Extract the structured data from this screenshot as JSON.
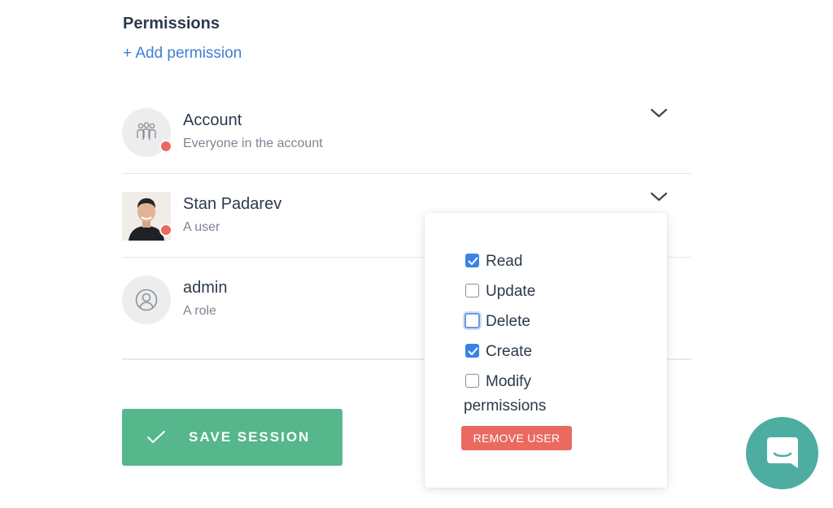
{
  "permissions": {
    "title": "Permissions",
    "add_label": "+ Add permission"
  },
  "entries": [
    {
      "name": "Account",
      "subtitle": "Everyone in the account",
      "icon": "people-group-icon",
      "status": "red"
    },
    {
      "name": "Stan Padarev",
      "subtitle": "A user",
      "icon": "user-photo",
      "status": "red"
    },
    {
      "name": "admin",
      "subtitle": "A role",
      "icon": "user-circle-icon"
    }
  ],
  "popover": {
    "options": [
      {
        "label": "Read",
        "checked": true
      },
      {
        "label": "Update",
        "checked": false
      },
      {
        "label": "Delete",
        "checked": false,
        "focused": true
      },
      {
        "label": "Create",
        "checked": true
      },
      {
        "label": "Modify",
        "label2": "permissions",
        "checked": false
      }
    ],
    "remove_label": "REMOVE USER"
  },
  "save": {
    "label": "SAVE SESSION"
  },
  "chat": {
    "icon": "chat-bubble-icon"
  },
  "colors": {
    "link": "#3f7fd6",
    "save": "#55b78b",
    "remove": "#ea6a60",
    "checkbox": "#3b82e6",
    "chat": "#4dada0",
    "status_dot": "#ea6a60"
  }
}
